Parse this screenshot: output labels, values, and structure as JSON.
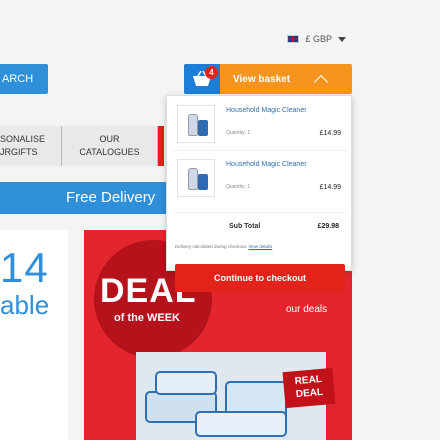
{
  "header": {
    "currency_label": "£ GBP"
  },
  "search": {
    "button_label": "ARCH"
  },
  "basket": {
    "count": "4",
    "view_label": "View basket",
    "items": [
      {
        "name": "Household Magic Cleaner",
        "qty": "Quantity: 1",
        "price": "£14.99"
      },
      {
        "name": "Household Magic Cleaner",
        "qty": "Quantity: 1",
        "price": "£14.99"
      }
    ],
    "subtotal_label": "Sub Total",
    "subtotal_value": "£29.98",
    "note_text": "Delivery calculated during checkout.",
    "note_link": "View details",
    "checkout_label": "Continue to checkout"
  },
  "nav": {
    "items": [
      {
        "line1": "SONALISE",
        "line2": "JRGIFTS"
      },
      {
        "line1": "OUR",
        "line2": "CATALOGUES"
      }
    ]
  },
  "promo": {
    "delivery_text": "Free Delivery",
    "hero_year": "14",
    "hero_word": "able",
    "deal_word": "DEAL",
    "deal_week": "of the WEEK",
    "our_deals": "our deals",
    "real_deal": "REAL DEAL"
  },
  "colors": {
    "accent_blue": "#2f8fd8",
    "basket_orange": "#f7941d",
    "checkout_red": "#e2231a"
  }
}
